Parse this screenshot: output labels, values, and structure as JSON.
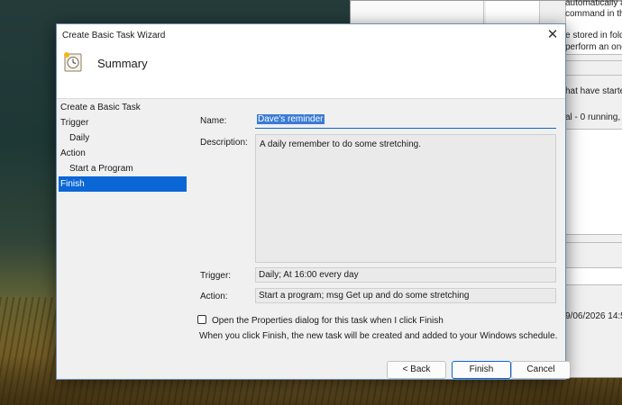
{
  "background_window": {
    "lines": [
      "automatically at the tir",
      "command in the Actio",
      "e stored in fold",
      "perform an one",
      "hat have starte",
      "al - 0 running,",
      "9/06/2026 14:5"
    ]
  },
  "dialog": {
    "title": "Create Basic Task Wizard",
    "close_icon": "close-icon",
    "header_title": "Summary",
    "header_icon": "task-clock-icon",
    "steps": [
      {
        "label": "Create a Basic Task"
      },
      {
        "label": "Trigger"
      },
      {
        "label": "Daily"
      },
      {
        "label": "Action"
      },
      {
        "label": "Start a Program"
      },
      {
        "label": "Finish"
      }
    ],
    "active_step": "Finish",
    "form": {
      "name_label": "Name:",
      "name_value": "Dave's reminder",
      "description_label": "Description:",
      "description_value": "A daily remember to do some stretching.",
      "trigger_label": "Trigger:",
      "trigger_value": "Daily; At 16:00 every day",
      "action_label": "Action:",
      "action_value": "Start a program; msg Get up and do some stretching"
    },
    "checkbox_label": "Open the Properties dialog for this task when I click Finish",
    "checkbox_checked": false,
    "info_text": "When you click Finish, the new task will be created and added to your Windows schedule.",
    "buttons": {
      "back": "< Back",
      "finish": "Finish",
      "cancel": "Cancel"
    }
  },
  "colors": {
    "accent": "#0b66d6",
    "dialog_bg": "#f0f0f0"
  }
}
